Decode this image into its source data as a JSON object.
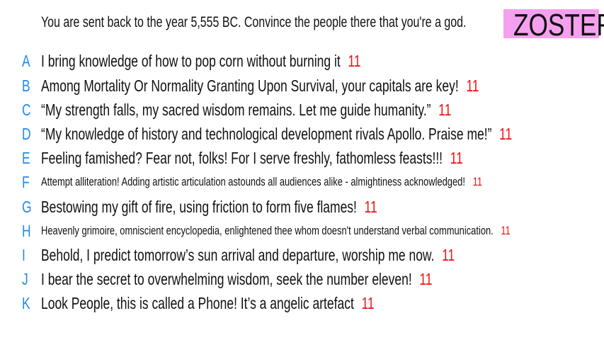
{
  "question": "You are sent back to the year 5,555 BC. Convince the people there that you're a god.",
  "badge": "ZOSTER",
  "colors": {
    "letter": "#1e8af0",
    "score": "#ee1111",
    "badge_bg": "#f5a0ee"
  },
  "answers": [
    {
      "letter": "A",
      "text": "I bring knowledge of how to pop corn without burning it",
      "score": "11"
    },
    {
      "letter": "B",
      "text": "Among Mortality Or Normality Granting Upon Survival, your capitals are key!",
      "score": "11"
    },
    {
      "letter": "C",
      "text": "“My strength falls, my sacred wisdom remains. Let me guide humanity.”",
      "score": "11"
    },
    {
      "letter": "D",
      "text": "“My knowledge of history and technological development rivals Apollo. Praise me!”",
      "score": "11"
    },
    {
      "letter": "E",
      "text": "Feeling famished? Fear not, folks! For I serve freshly, fathomless feasts!!!",
      "score": "11"
    },
    {
      "letter": "F",
      "text": "Attempt alliteration! Adding artistic articulation astounds all audiences alike - almightiness acknowledged!",
      "score": "11"
    },
    {
      "letter": "G",
      "text": "Bestowing my gift of fire, using friction to form five flames!",
      "score": "11"
    },
    {
      "letter": "H",
      "text": "Heavenly grimoire, omniscient encyclopedia, enlightened thee whom doesn't understand verbal communication.",
      "score": "11"
    },
    {
      "letter": "I",
      "text": "Behold, I predict tomorrow’s sun arrival and departure, worship me now.",
      "score": "11"
    },
    {
      "letter": "J",
      "text": "I bear the secret to overwhelming wisdom, seek the number eleven!",
      "score": "11"
    },
    {
      "letter": "K",
      "text": "Look People, this is called a Phone! It’s a angelic artefact",
      "score": "11"
    }
  ]
}
